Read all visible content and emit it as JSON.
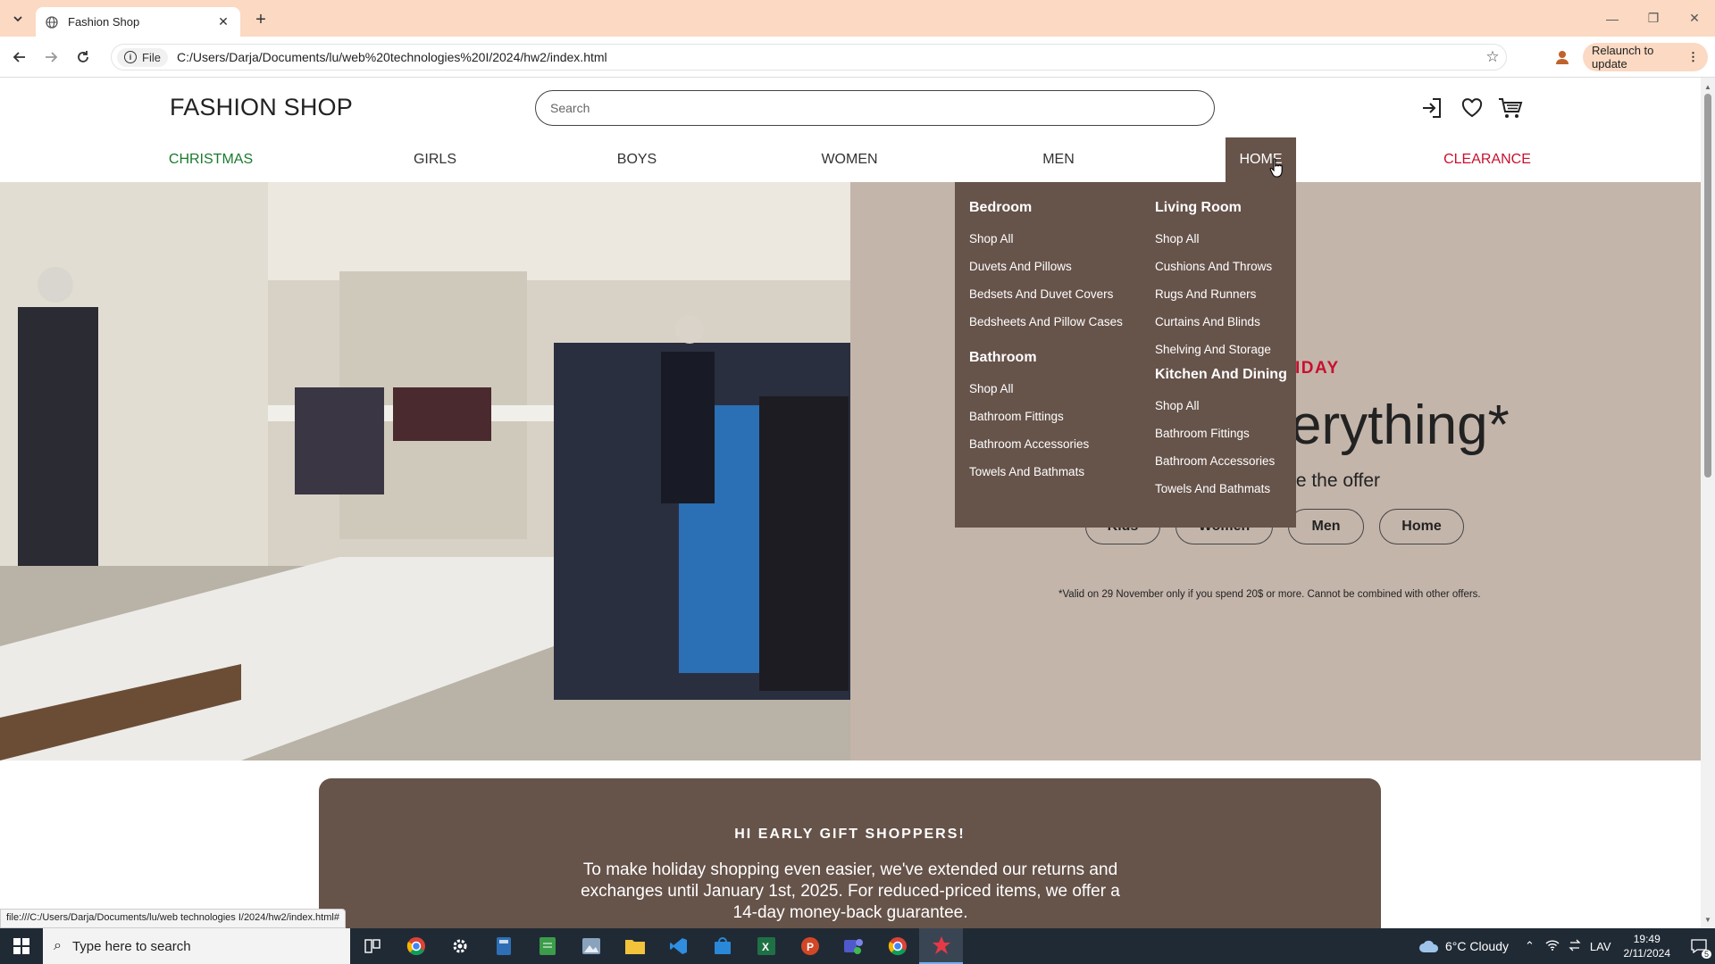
{
  "browser": {
    "tab_title": "Fashion Shop",
    "site_chip": "File",
    "url": "C:/Users/Darja/Documents/lu/web%20technologies%20I/2024/hw2/index.html",
    "relaunch_label": "Relaunch to update",
    "status_url": "file:///C:/Users/Darja/Documents/lu/web technologies I/2024/hw2/index.html#"
  },
  "site": {
    "logo": "FASHION SHOP",
    "search_placeholder": "Search"
  },
  "nav": {
    "items": [
      "CHRISTMAS",
      "GIRLS",
      "BOYS",
      "WOMEN",
      "MEN",
      "HOME",
      "CLEARANCE"
    ],
    "active": "HOME",
    "colors": {
      "christmas": "#1a7a2e",
      "clearance": "#c8102e",
      "active_bg": "#66534a"
    }
  },
  "dropdown": {
    "bedroom": {
      "title": "Bedroom",
      "links": [
        "Shop All",
        "Duvets And Pillows",
        "Bedsets And Duvet Covers",
        "Bedsheets And Pillow Cases"
      ]
    },
    "bathroom": {
      "title": "Bathroom",
      "links": [
        "Shop All",
        "Bathroom Fittings",
        "Bathroom Accessories",
        "Towels And Bathmats"
      ]
    },
    "living_room": {
      "title": "Living Room",
      "links": [
        "Shop All",
        "Cushions And Throws",
        "Rugs And Runners",
        "Curtains And Blinds",
        "Shelving And Storage"
      ]
    },
    "kitchen": {
      "title": "Kitchen And Dining",
      "links": [
        "Shop All",
        "Bathroom Fittings",
        "Bathroom Accessories",
        "Towels And Bathmats"
      ]
    }
  },
  "hero": {
    "kicker": "IDAY",
    "headline": "erything*",
    "subtitle": "te the offer",
    "buttons": [
      "Kids",
      "Women",
      "Men",
      "Home"
    ],
    "fineprint": "*Valid on 29 November only if you spend 20$ or more. Cannot be combined with other offers."
  },
  "promo": {
    "title": "HI EARLY GIFT SHOPPERS!",
    "text": "To make holiday shopping even easier, we've extended our returns and exchanges until January 1st, 2025. For reduced-priced items, we offer a 14-day money-back guarantee."
  },
  "taskbar": {
    "search_placeholder": "Type here to search",
    "apps": [
      "task-view",
      "chrome",
      "settings",
      "calculator",
      "notepad",
      "photos",
      "file-explorer",
      "vscode",
      "store",
      "excel",
      "powerpoint",
      "teams",
      "chrome-alt",
      "paint"
    ],
    "weather": "6°C  Cloudy",
    "language": "LAV",
    "time": "19:49",
    "date": "2/11/2024",
    "notifications": "5"
  }
}
